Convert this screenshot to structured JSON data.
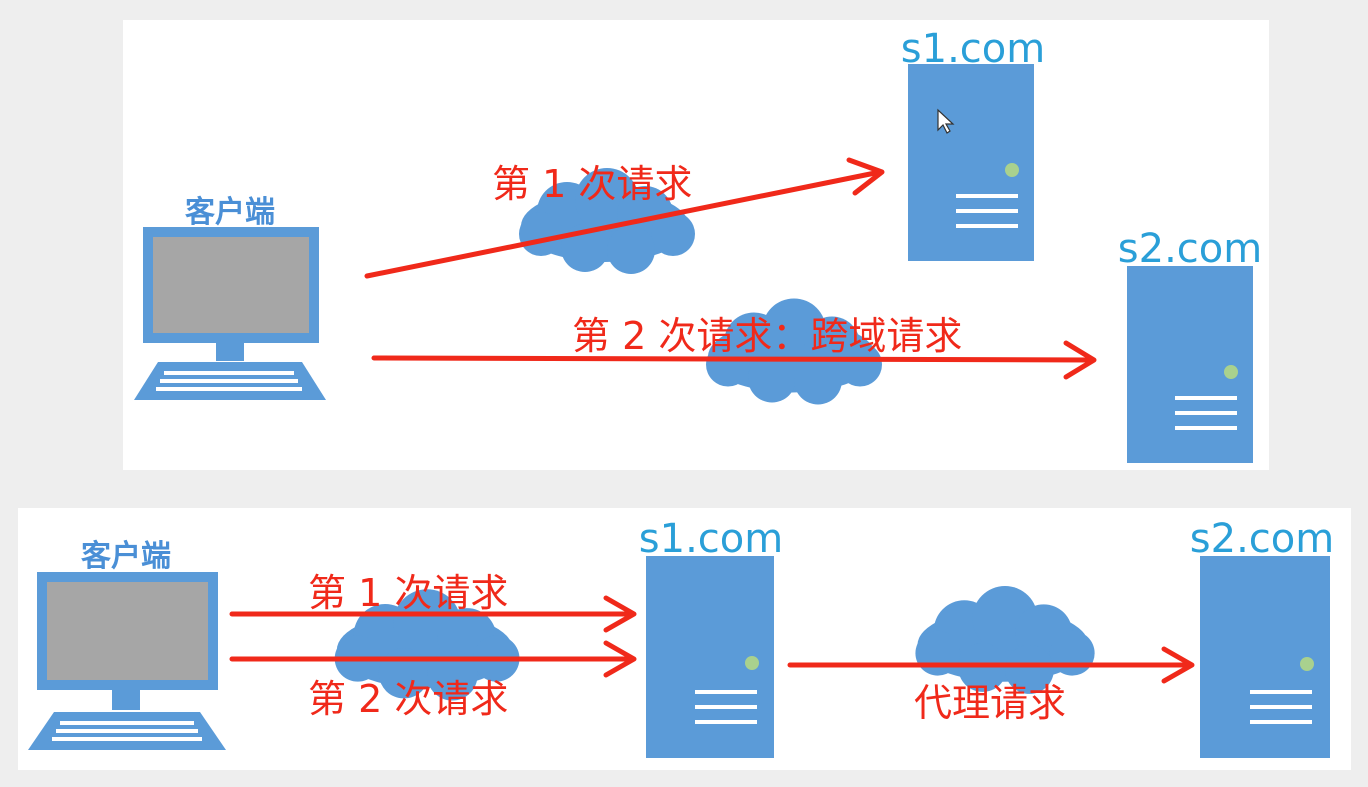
{
  "colors": {
    "page_background": "#eeeeee",
    "panel_background": "#ffffff",
    "server_blue": "#5b9bd8",
    "cloud_blue": "#5b9bd8",
    "arrow_red": "#f0291a",
    "label_blue": "#2a9fd8",
    "screen_gray": "#a6a6a6",
    "indicator_green": "#a9d18e"
  },
  "top_diagram": {
    "client_label": "客户端",
    "server1_label": "s1.com",
    "server2_label": "s2.com",
    "request1_label": "第 1 次请求",
    "request2_label": "第 2 次请求：跨域请求"
  },
  "bottom_diagram": {
    "client_label": "客户端",
    "server1_label": "s1.com",
    "server2_label": "s2.com",
    "request1_label": "第 1 次请求",
    "request2_label": "第 2 次请求",
    "proxy_label": "代理请求"
  }
}
